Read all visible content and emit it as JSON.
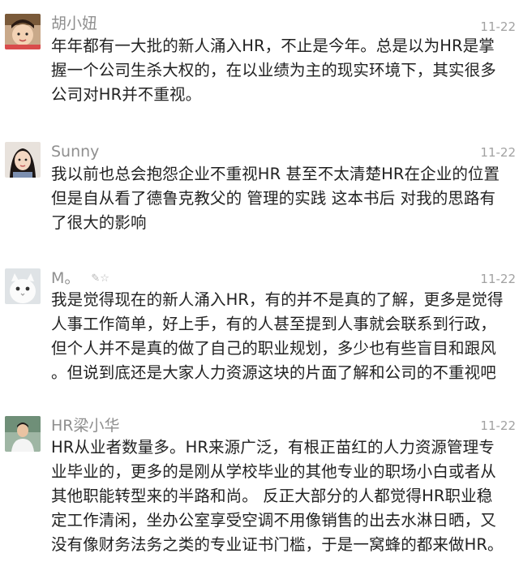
{
  "comments": [
    {
      "name": "胡小妞",
      "date": "11-22",
      "lines": [
        "年年都有一大批的新人涌入HR，不止是今年。总是以为HR是掌",
        "握一个公司生杀大权的，在以业绩为主的现实环境下，其实很多",
        "公司对HR并不重视。"
      ],
      "avatar_icon": "girl-photo-avatar"
    },
    {
      "name": "Sunny",
      "date": "11-22",
      "lines": [
        "我以前也总会抱怨企业不重视HR 甚至不太清楚HR在企业的位置",
        "但是自从看了德鲁克教父的 管理的实践 这本书后 对我的思路有",
        "了很大的影响"
      ],
      "avatar_icon": "woman-photo-avatar"
    },
    {
      "name": "M。",
      "name_decoration": "✎☆",
      "date": "11-22",
      "lines": [
        "我是觉得现在的新人涌入HR，有的并不是真的了解，更多是觉得",
        "人事工作简单，好上手，有的人甚至提到人事就会联系到行政，",
        "但个人并不是真的做了自己的职业规划，多少也有些盲目和跟风",
        "。但说到底还是大家人力资源这块的片面了解和公司的不重视吧"
      ],
      "avatar_icon": "white-cat-avatar"
    },
    {
      "name": "HR梁小华",
      "date": "11-22",
      "lines": [
        "HR从业者数量多。HR来源广泛，有根正苗红的人力资源管理专",
        "业毕业的，更多的是刚从学校毕业的其他专业的职场小白或者从",
        "其他职能转型来的半路和尚。 反正大部分的人都觉得HR职业稳",
        "定工作清闲，坐办公室享受空调不用像销售的出去水淋日晒，又",
        "没有像财务法务之类的专业证书门槛，于是一窝蜂的都来做HR。"
      ],
      "avatar_icon": "man-photo-avatar"
    }
  ],
  "colors": {
    "name": "#8f8f8f",
    "date": "#a2a2a2",
    "text": "#222222"
  }
}
